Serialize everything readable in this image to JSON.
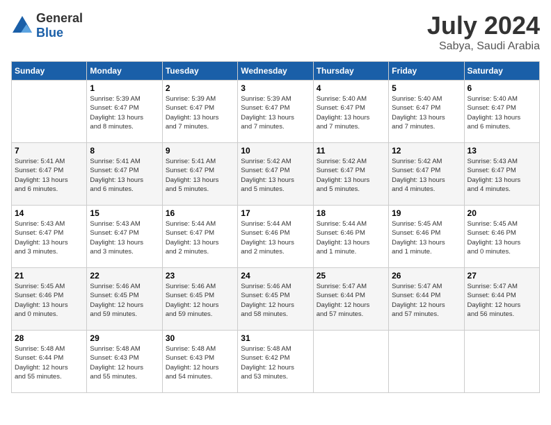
{
  "logo": {
    "text_general": "General",
    "text_blue": "Blue"
  },
  "title": "July 2024",
  "location": "Sabya, Saudi Arabia",
  "days_of_week": [
    "Sunday",
    "Monday",
    "Tuesday",
    "Wednesday",
    "Thursday",
    "Friday",
    "Saturday"
  ],
  "weeks": [
    [
      {
        "day": "",
        "info": ""
      },
      {
        "day": "1",
        "info": "Sunrise: 5:39 AM\nSunset: 6:47 PM\nDaylight: 13 hours\nand 8 minutes."
      },
      {
        "day": "2",
        "info": "Sunrise: 5:39 AM\nSunset: 6:47 PM\nDaylight: 13 hours\nand 7 minutes."
      },
      {
        "day": "3",
        "info": "Sunrise: 5:39 AM\nSunset: 6:47 PM\nDaylight: 13 hours\nand 7 minutes."
      },
      {
        "day": "4",
        "info": "Sunrise: 5:40 AM\nSunset: 6:47 PM\nDaylight: 13 hours\nand 7 minutes."
      },
      {
        "day": "5",
        "info": "Sunrise: 5:40 AM\nSunset: 6:47 PM\nDaylight: 13 hours\nand 7 minutes."
      },
      {
        "day": "6",
        "info": "Sunrise: 5:40 AM\nSunset: 6:47 PM\nDaylight: 13 hours\nand 6 minutes."
      }
    ],
    [
      {
        "day": "7",
        "info": "Sunrise: 5:41 AM\nSunset: 6:47 PM\nDaylight: 13 hours\nand 6 minutes."
      },
      {
        "day": "8",
        "info": "Sunrise: 5:41 AM\nSunset: 6:47 PM\nDaylight: 13 hours\nand 6 minutes."
      },
      {
        "day": "9",
        "info": "Sunrise: 5:41 AM\nSunset: 6:47 PM\nDaylight: 13 hours\nand 5 minutes."
      },
      {
        "day": "10",
        "info": "Sunrise: 5:42 AM\nSunset: 6:47 PM\nDaylight: 13 hours\nand 5 minutes."
      },
      {
        "day": "11",
        "info": "Sunrise: 5:42 AM\nSunset: 6:47 PM\nDaylight: 13 hours\nand 5 minutes."
      },
      {
        "day": "12",
        "info": "Sunrise: 5:42 AM\nSunset: 6:47 PM\nDaylight: 13 hours\nand 4 minutes."
      },
      {
        "day": "13",
        "info": "Sunrise: 5:43 AM\nSunset: 6:47 PM\nDaylight: 13 hours\nand 4 minutes."
      }
    ],
    [
      {
        "day": "14",
        "info": "Sunrise: 5:43 AM\nSunset: 6:47 PM\nDaylight: 13 hours\nand 3 minutes."
      },
      {
        "day": "15",
        "info": "Sunrise: 5:43 AM\nSunset: 6:47 PM\nDaylight: 13 hours\nand 3 minutes."
      },
      {
        "day": "16",
        "info": "Sunrise: 5:44 AM\nSunset: 6:47 PM\nDaylight: 13 hours\nand 2 minutes."
      },
      {
        "day": "17",
        "info": "Sunrise: 5:44 AM\nSunset: 6:46 PM\nDaylight: 13 hours\nand 2 minutes."
      },
      {
        "day": "18",
        "info": "Sunrise: 5:44 AM\nSunset: 6:46 PM\nDaylight: 13 hours\nand 1 minute."
      },
      {
        "day": "19",
        "info": "Sunrise: 5:45 AM\nSunset: 6:46 PM\nDaylight: 13 hours\nand 1 minute."
      },
      {
        "day": "20",
        "info": "Sunrise: 5:45 AM\nSunset: 6:46 PM\nDaylight: 13 hours\nand 0 minutes."
      }
    ],
    [
      {
        "day": "21",
        "info": "Sunrise: 5:45 AM\nSunset: 6:46 PM\nDaylight: 13 hours\nand 0 minutes."
      },
      {
        "day": "22",
        "info": "Sunrise: 5:46 AM\nSunset: 6:45 PM\nDaylight: 12 hours\nand 59 minutes."
      },
      {
        "day": "23",
        "info": "Sunrise: 5:46 AM\nSunset: 6:45 PM\nDaylight: 12 hours\nand 59 minutes."
      },
      {
        "day": "24",
        "info": "Sunrise: 5:46 AM\nSunset: 6:45 PM\nDaylight: 12 hours\nand 58 minutes."
      },
      {
        "day": "25",
        "info": "Sunrise: 5:47 AM\nSunset: 6:44 PM\nDaylight: 12 hours\nand 57 minutes."
      },
      {
        "day": "26",
        "info": "Sunrise: 5:47 AM\nSunset: 6:44 PM\nDaylight: 12 hours\nand 57 minutes."
      },
      {
        "day": "27",
        "info": "Sunrise: 5:47 AM\nSunset: 6:44 PM\nDaylight: 12 hours\nand 56 minutes."
      }
    ],
    [
      {
        "day": "28",
        "info": "Sunrise: 5:48 AM\nSunset: 6:44 PM\nDaylight: 12 hours\nand 55 minutes."
      },
      {
        "day": "29",
        "info": "Sunrise: 5:48 AM\nSunset: 6:43 PM\nDaylight: 12 hours\nand 55 minutes."
      },
      {
        "day": "30",
        "info": "Sunrise: 5:48 AM\nSunset: 6:43 PM\nDaylight: 12 hours\nand 54 minutes."
      },
      {
        "day": "31",
        "info": "Sunrise: 5:48 AM\nSunset: 6:42 PM\nDaylight: 12 hours\nand 53 minutes."
      },
      {
        "day": "",
        "info": ""
      },
      {
        "day": "",
        "info": ""
      },
      {
        "day": "",
        "info": ""
      }
    ]
  ]
}
